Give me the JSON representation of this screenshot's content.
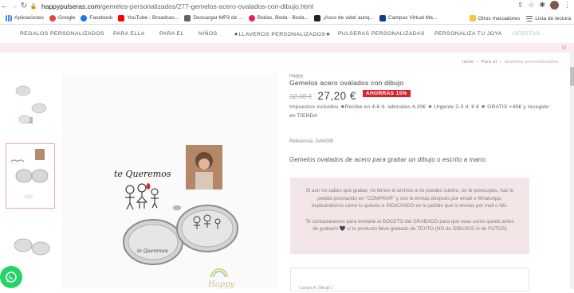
{
  "browser": {
    "url_host": "happypulseras.com",
    "url_path": "/gemelos-personalizados/277-gemelos-acero-ovalados-con-dibujo.html",
    "bookmarks": [
      {
        "label": "Aplicaciones",
        "color": "#4285f4"
      },
      {
        "label": "Google",
        "color": "#ea4335"
      },
      {
        "label": "Facebook",
        "color": "#1877f2"
      },
      {
        "label": "YouTube - Broadcas...",
        "color": "#ff0000"
      },
      {
        "label": "Descargar MP3 de ...",
        "color": "#5f6368"
      },
      {
        "label": "Bodas, Boda - Boda...",
        "color": "#e91e63"
      },
      {
        "label": "¡Asco de vida! aunq...",
        "color": "#222222"
      },
      {
        "label": "Campus Virtual Ma...",
        "color": "#0b3d91"
      }
    ],
    "other_bookmarks": "Otros marcadores",
    "reading_list": "Lista de lectura"
  },
  "nav": {
    "items": [
      "REGALOS PERSONALIZADOS",
      "PARA ELLA",
      "PARA EL",
      "NIÑOS",
      "★LLAVEROS PERSONALIZADOS★",
      "PULSERAS PERSONALIZADAS",
      "PERSONALIZA TU JOYA",
      "OFERTAS"
    ]
  },
  "breadcrumb": {
    "items": [
      "Inicio",
      "Para él",
      "Gemelos personalizados"
    ]
  },
  "product": {
    "brand": "Happy",
    "title": "Gemelos acero ovalados con dibujo",
    "old_price": "32,00 €",
    "price": "27,20 €",
    "discount": "AHORRAS 15%",
    "tax_info": "Impuestos incluidos ★Recibe en 4-6 d. laborales 4,20€ ★ Urgente 2-3 d. 8 € ★ GRATIS +45€ y recogido en TIENDA",
    "reference": "Referencia: GAH005",
    "description": "Gemelos ovalados de acero para grabar un dibujo o escrito a mano.",
    "info_p1": "Si aún no sabes qué grabar, no tienes el archivo a no puedes subirlo, no te preocupes, haz tu pedido pinchando en \"COMPRAR\" y nos lo envías después por email o WhatsApp, explicándonos cómo lo quieres e INDICANDO en tu pedido que lo envías por mail o Ws.",
    "info_p2": "Te contactaremos para enviarte el BOCETO del GRABADO para que veas como quedó antes de grabarlo 🖤 si tu producto lleva grabado de TEXTO (NO de DIBUJOS ni de FOTOS)",
    "option_label": "Campo A: Dibujo 1"
  },
  "image": {
    "handwriting": "te Queremos",
    "cufflink_text": "te Queremos",
    "logo_text": "Happy"
  }
}
